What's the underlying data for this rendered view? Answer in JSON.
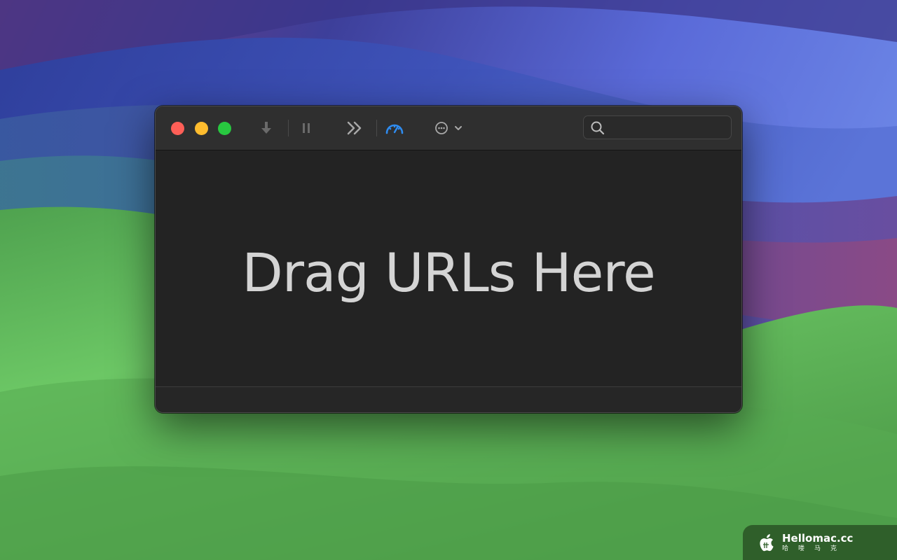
{
  "window": {
    "title": "",
    "drop_hint": "Drag URLs Here"
  },
  "toolbar": {
    "items": [
      {
        "name": "download-icon",
        "label": ""
      },
      {
        "name": "pause-icon",
        "label": ""
      },
      {
        "name": "skip-forward-icon",
        "label": ""
      },
      {
        "name": "speed-gauge-icon",
        "label": ""
      },
      {
        "name": "more-options-icon",
        "label": ""
      }
    ],
    "search_placeholder": "",
    "search_value": ""
  },
  "colors": {
    "traffic_close": "#fe5f57",
    "traffic_minimize": "#febc2e",
    "traffic_zoom": "#28c840",
    "accent": "#2f8cf0",
    "window_bg": "#232323"
  },
  "watermark": {
    "title": "Hellomac.cc",
    "subtitle": "哈喽马克"
  }
}
